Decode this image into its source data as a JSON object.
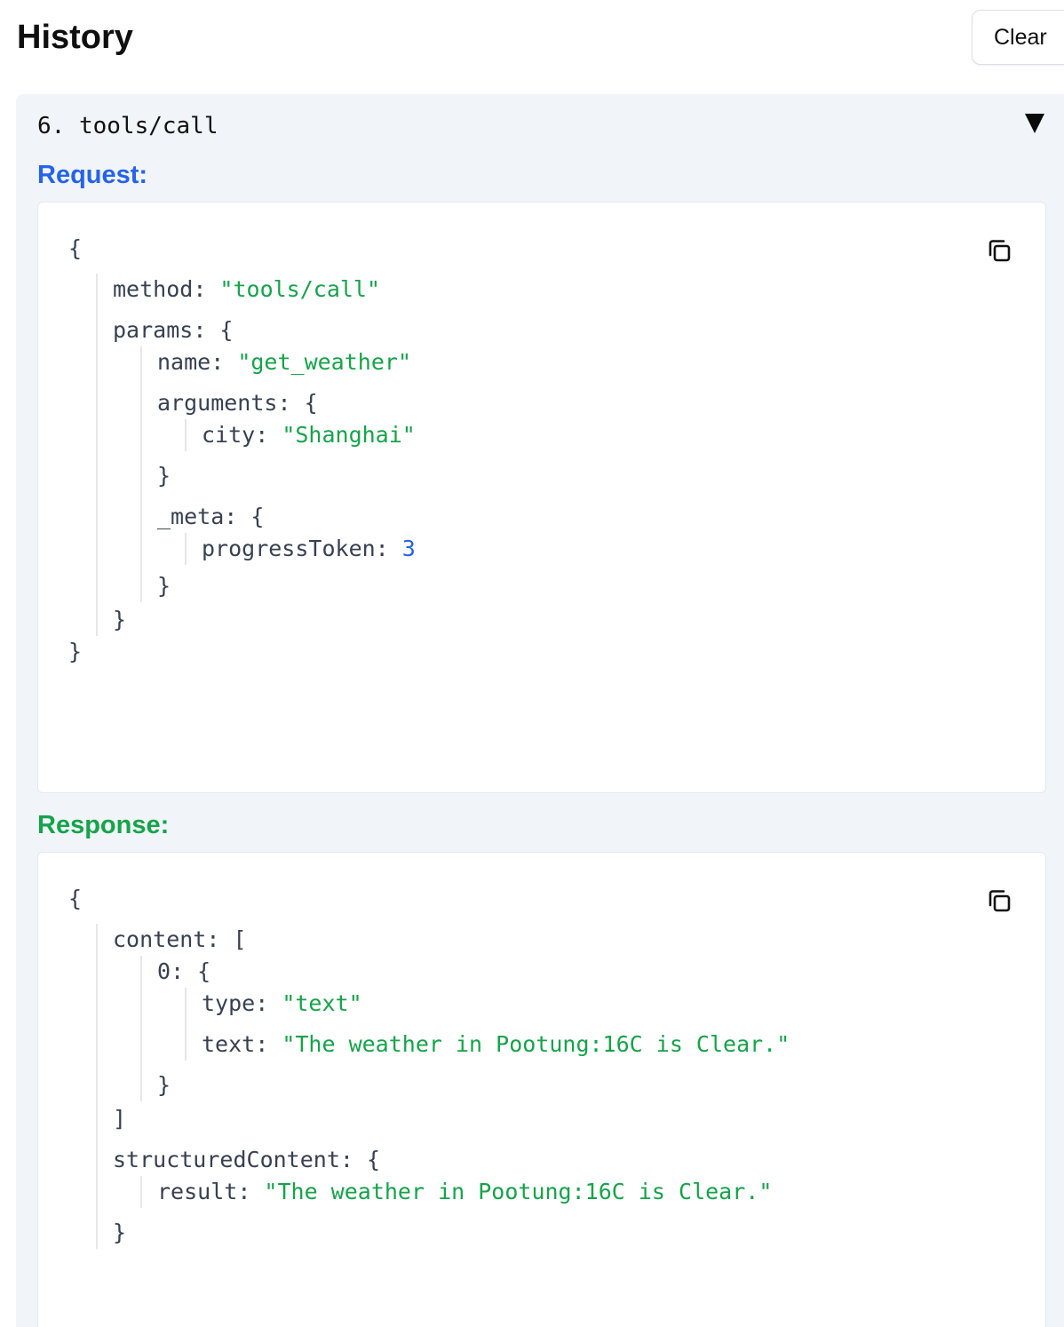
{
  "header": {
    "title": "History",
    "clear_label": "Clear"
  },
  "entry": {
    "title": "6. tools/call",
    "request_label": "Request:",
    "response_label": "Response:"
  },
  "request": {
    "method_key": "method",
    "method_value": "\"tools/call\"",
    "params_key": "params",
    "name_key": "name",
    "name_value": "\"get_weather\"",
    "arguments_key": "arguments",
    "city_key": "city",
    "city_value": "\"Shanghai\"",
    "meta_key": "_meta",
    "progress_key": "progressToken",
    "progress_value": "3"
  },
  "response": {
    "content_key": "content",
    "index_key": "0",
    "type_key": "type",
    "type_value": "\"text\"",
    "text_key": "text",
    "text_value": "\"The weather in Pootung:16C is Clear.\"",
    "structured_key": "structuredContent",
    "result_key": "result",
    "result_value": "\"The weather in Pootung:16C is Clear.\""
  },
  "colors": {
    "request_label": "#2563eb",
    "response_label": "#16a34a",
    "string_value": "#16a34a",
    "number_value": "#2563eb",
    "panel_background": "#f1f5f9"
  },
  "icons": {
    "toggle": "triangle-down-icon",
    "copy": "copy-icon"
  }
}
